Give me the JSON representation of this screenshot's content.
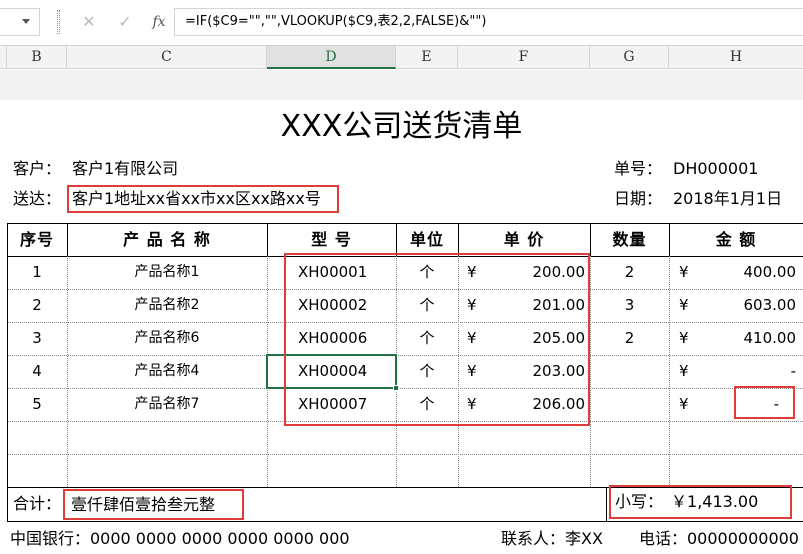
{
  "formula_bar": {
    "name_box": "",
    "cancel_icon": "✕",
    "enter_icon": "✓",
    "fx_label": "fx",
    "formula": "=IF($C9=\"\",\"\",VLOOKUP($C9,表2,2,FALSE)&\"\")"
  },
  "columns": [
    "B",
    "C",
    "D",
    "E",
    "F",
    "G",
    "H"
  ],
  "selected_column": "D",
  "sheet": {
    "title": "XXX公司送货清单",
    "customer_label": "客户：",
    "customer_value": "客户1有限公司",
    "address_label": "送达：",
    "address_value": "客户1地址xx省xx市xx区xx路xx号",
    "order_label": "单号：",
    "order_value": "DH000001",
    "date_label": "日期：",
    "date_value": "2018年1月1日",
    "headers": {
      "seq": "序号",
      "name": "产 品 名 称",
      "model": "型 号",
      "unit": "单位",
      "price": "单  价",
      "qty": "数量",
      "amount": "金  额"
    },
    "rows": [
      {
        "seq": "1",
        "name": "产品名称1",
        "model": "XH00001",
        "unit": "个",
        "cur": "¥",
        "price": "200.00",
        "qty": "2",
        "amt_cur": "¥",
        "amount": "400.00"
      },
      {
        "seq": "2",
        "name": "产品名称2",
        "model": "XH00002",
        "unit": "个",
        "cur": "¥",
        "price": "201.00",
        "qty": "3",
        "amt_cur": "¥",
        "amount": "603.00"
      },
      {
        "seq": "3",
        "name": "产品名称6",
        "model": "XH00006",
        "unit": "个",
        "cur": "¥",
        "price": "205.00",
        "qty": "2",
        "amt_cur": "¥",
        "amount": "410.00"
      },
      {
        "seq": "4",
        "name": "产品名称4",
        "model": "XH00004",
        "unit": "个",
        "cur": "¥",
        "price": "203.00",
        "qty": "",
        "amt_cur": "¥",
        "amount": "-"
      },
      {
        "seq": "5",
        "name": "产品名称7",
        "model": "XH00007",
        "unit": "个",
        "cur": "¥",
        "price": "206.00",
        "qty": "",
        "amt_cur": "¥",
        "amount": "-"
      }
    ],
    "total_label": "合计：",
    "total_words": "壹仟肆佰壹拾叁元整",
    "small_label": "小写：",
    "small_value": "￥1,413.00",
    "bank": "中国银行：0000 0000 0000 0000 0000 000",
    "contact": "联系人：李XX",
    "phone": "电话：00000000000"
  }
}
